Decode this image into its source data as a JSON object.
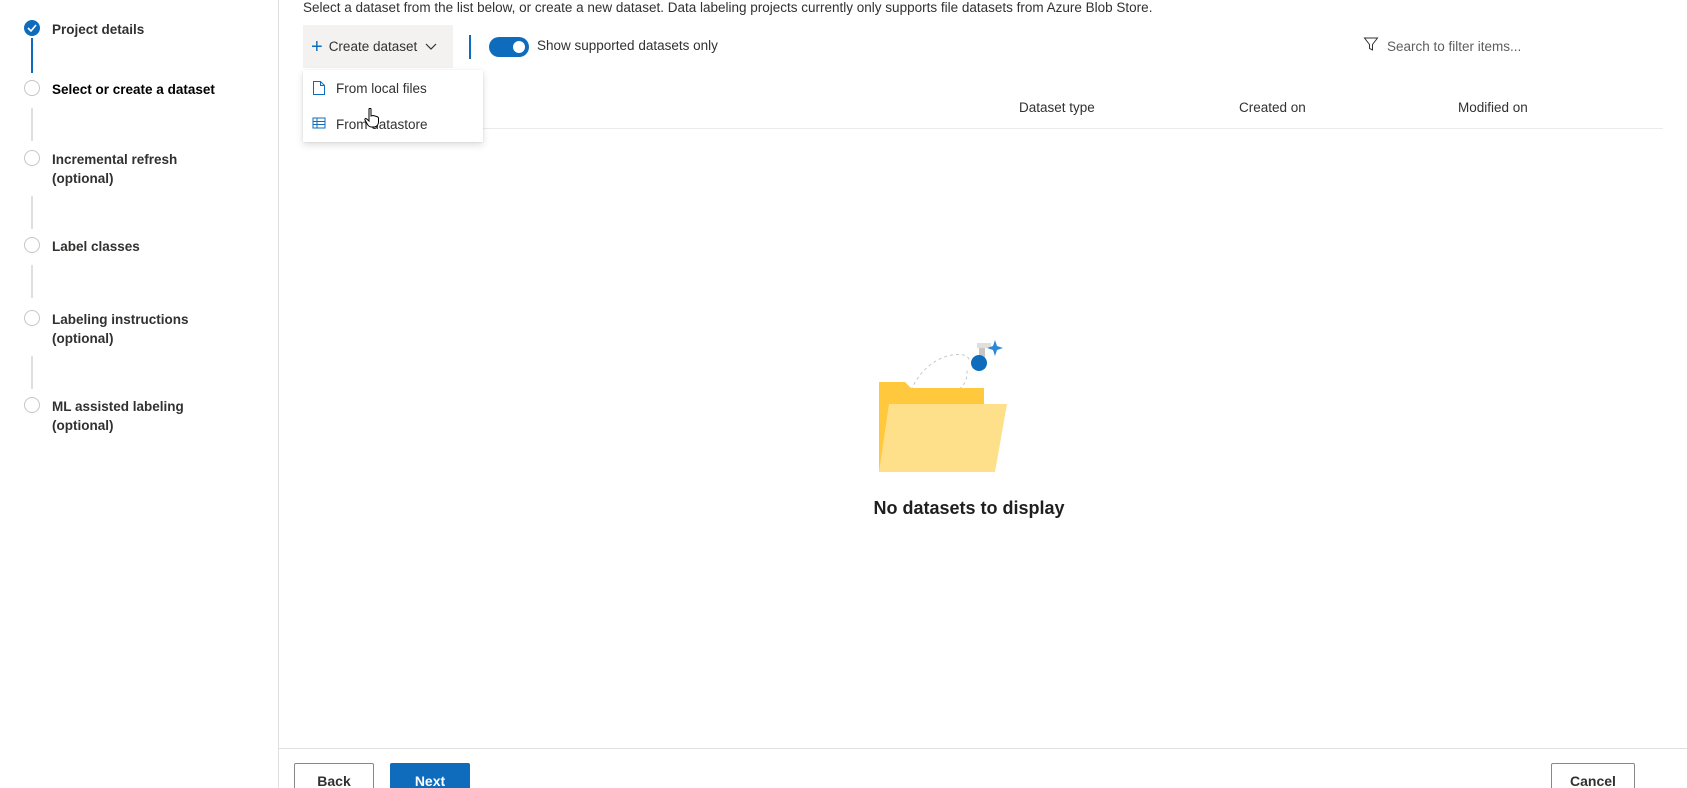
{
  "stepper": {
    "steps": [
      {
        "label": "Project details",
        "state": "done"
      },
      {
        "label": "Select or create a dataset",
        "state": "current"
      },
      {
        "label": "Incremental refresh (optional)",
        "state": "pending"
      },
      {
        "label": "Label classes",
        "state": "pending"
      },
      {
        "label": "Labeling instructions (optional)",
        "state": "pending"
      },
      {
        "label": "ML assisted labeling (optional)",
        "state": "pending"
      }
    ]
  },
  "main": {
    "description": "Select a dataset from the list below, or create a new dataset. Data labeling projects currently only supports file datasets from Azure Blob Store.",
    "create_label": "Create dataset",
    "toggle_label": "Show supported datasets only",
    "toggle_on": true,
    "search_placeholder": "Search to filter items...",
    "columns": [
      "Dataset type",
      "Created on",
      "Modified on"
    ],
    "empty_text": "No datasets to display",
    "dropdown": {
      "items": [
        {
          "label": "From local files",
          "icon": "file-icon"
        },
        {
          "label": "From datastore",
          "icon": "table-icon"
        }
      ]
    }
  },
  "footer": {
    "back": "Back",
    "next": "Next",
    "cancel": "Cancel"
  },
  "colors": {
    "accent": "#0f6cbd",
    "folder": "#ffc83d",
    "folder_light": "#ffe08a"
  }
}
